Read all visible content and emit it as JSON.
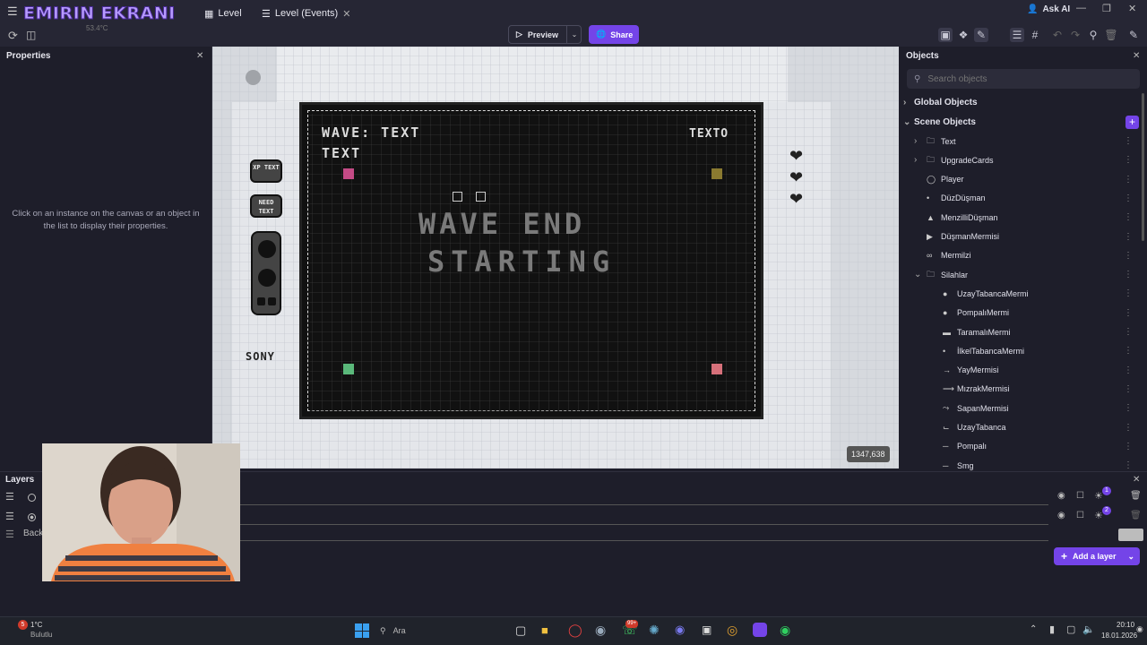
{
  "stream_overlay": {
    "title": "EMIRIN EKRANI",
    "sub": "53.4°C"
  },
  "tabs": [
    {
      "label": "Level"
    },
    {
      "label": "Level (Events)"
    }
  ],
  "topbar": {
    "ask_ai": "Ask AI",
    "preview": "Preview",
    "share": "Share"
  },
  "properties": {
    "title": "Properties",
    "hint": "Click on an instance on the canvas or an object in the list to display their properties."
  },
  "scene": {
    "wave_text": "WAVE: TEXT",
    "text_label": "TEXT",
    "texto_label": "TEXTO",
    "banner_line1": "WAVE END",
    "banner_line2": "STARTING",
    "xp_text": "XP TEXT",
    "need_text": "NEED TEXT",
    "brand": "SONY",
    "coords": "1347,638"
  },
  "objects": {
    "title": "Objects",
    "search_placeholder": "Search objects",
    "global_label": "Global Objects",
    "scene_label": "Scene Objects",
    "items": [
      {
        "label": "Text",
        "indent": 1,
        "kind": "folder",
        "expand": "right"
      },
      {
        "label": "UpgradeCards",
        "indent": 1,
        "kind": "folder",
        "expand": "right"
      },
      {
        "label": "Player",
        "indent": 1,
        "kind": "player",
        "expand": ""
      },
      {
        "label": "DüzDüşman",
        "indent": 1,
        "kind": "dot-small",
        "expand": ""
      },
      {
        "label": "MenzilliDüşman",
        "indent": 1,
        "kind": "blob",
        "expand": ""
      },
      {
        "label": "DüşmanMermisi",
        "indent": 1,
        "kind": "play",
        "expand": ""
      },
      {
        "label": "Mermilzi",
        "indent": 1,
        "kind": "scribble",
        "expand": ""
      },
      {
        "label": "Silahlar",
        "indent": 1,
        "kind": "folder",
        "expand": "down"
      },
      {
        "label": "UzayTabancaMermi",
        "indent": 2,
        "kind": "dot",
        "expand": ""
      },
      {
        "label": "PompalıMermi",
        "indent": 2,
        "kind": "dot",
        "expand": ""
      },
      {
        "label": "TaramalıMermi",
        "indent": 2,
        "kind": "dash",
        "expand": ""
      },
      {
        "label": "İlkelTabancaMermi",
        "indent": 2,
        "kind": "dot-small",
        "expand": ""
      },
      {
        "label": "YayMermisi",
        "indent": 2,
        "kind": "arrow",
        "expand": ""
      },
      {
        "label": "MızrakMermisi",
        "indent": 2,
        "kind": "spear",
        "expand": ""
      },
      {
        "label": "SapanMermisi",
        "indent": 2,
        "kind": "sling",
        "expand": ""
      },
      {
        "label": "UzayTabanca",
        "indent": 2,
        "kind": "gun",
        "expand": ""
      },
      {
        "label": "Pompalı",
        "indent": 2,
        "kind": "shotgun",
        "expand": ""
      },
      {
        "label": "Smg",
        "indent": 2,
        "kind": "smg",
        "expand": ""
      }
    ]
  },
  "layers": {
    "title": "Layers",
    "back_label": "Back",
    "add_layer": "Add a layer",
    "badge1": "1",
    "badge2": "2"
  },
  "taskbar": {
    "weather_temp": "1°C",
    "weather_desc": "Bulutlu",
    "weather_badge": "5",
    "search": "Ara",
    "badge": "99+",
    "time": "20:10",
    "date": "18.01.2026"
  }
}
